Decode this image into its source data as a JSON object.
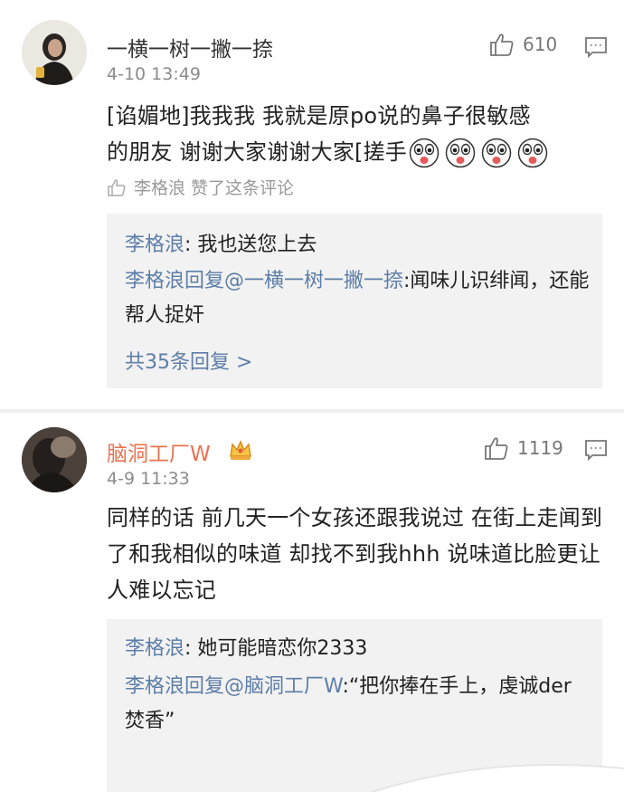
{
  "comments": [
    {
      "username": "一横一树一撇一捺",
      "time": "4-10 13:49",
      "likes": "610",
      "text_line1": "[谄媚地]我我我 我就是原po说的鼻子很敏感",
      "text_line2": "的朋友 谢谢大家谢谢大家[搓手",
      "liked_by": "李格浪 赞了这条评论",
      "replies": [
        {
          "name": "李格浪",
          "text": ": 我也送您上去"
        },
        {
          "name": "李格浪回复@一横一树一撇一捺",
          "text": ":闻味儿识绯闻，还能帮人捉奸"
        }
      ],
      "more_replies": "共35条回复 >"
    },
    {
      "username": "脑洞工厂W",
      "time": "4-9 11:33",
      "likes": "1119",
      "text": "同样的话 前几天一个女孩还跟我说过 在街上走闻到了和我相似的味道 却找不到我hhh 说味道比脸更让人难以忘记",
      "replies": [
        {
          "name": "李格浪",
          "text": ": 她可能暗恋你2333"
        },
        {
          "name": "李格浪回复@脑洞工厂W",
          "text": ":“把你捧在手上，虔诚der焚香”"
        }
      ]
    }
  ],
  "colors": {
    "link": "#5d7ea8",
    "vip_name": "#eb7350",
    "reply_bg": "#f2f2f2"
  },
  "icons": [
    "thumbs-up-icon",
    "comment-icon",
    "crown-icon",
    "emoji-icon"
  ]
}
